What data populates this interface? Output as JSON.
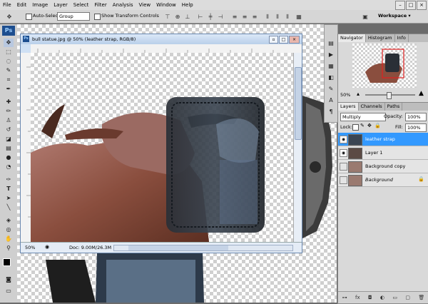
{
  "menu": {
    "logo": "Ps",
    "items": [
      "File",
      "Edit",
      "Image",
      "Layer",
      "Select",
      "Filter",
      "Analysis",
      "View",
      "Window",
      "Help"
    ],
    "window_controls": [
      "–",
      "□",
      "×"
    ]
  },
  "options": {
    "auto_select_label": "Auto-Select:",
    "auto_select_value": "Group",
    "show_transform_label": "Show Transform Controls",
    "workspace_label": "Workspace ▾"
  },
  "document": {
    "title": "bull statue.jpg @ 50% (leather strap, RGB/8)",
    "zoom": "50%",
    "doc_info": "Doc: 9.00M/26.3M",
    "title_buttons": [
      "▫",
      "□",
      "×"
    ]
  },
  "navigator": {
    "tabs": [
      "Navigator",
      "Histogram",
      "Info"
    ],
    "zoom": "50%"
  },
  "layers": {
    "tabs": [
      "Layers",
      "Channels",
      "Paths"
    ],
    "blend_mode": "Multiply",
    "opacity_label": "Opacity:",
    "opacity_value": "100%",
    "lock_label": "Lock:",
    "fill_label": "Fill:",
    "fill_value": "100%",
    "items": [
      {
        "name": "leather strap",
        "selected": true,
        "visible": true
      },
      {
        "name": "Layer 1",
        "selected": false,
        "visible": true
      },
      {
        "name": "Background copy",
        "selected": false,
        "visible": false
      },
      {
        "name": "Background",
        "selected": false,
        "visible": false,
        "locked": true
      }
    ],
    "footer_icons": [
      "link-icon",
      "fx-icon",
      "mask-icon",
      "adjustment-icon",
      "folder-icon",
      "new-layer-icon",
      "trash-icon"
    ],
    "footer_glyphs": [
      "⊶",
      "fx",
      "◘",
      "◐",
      "▭",
      "▢",
      "🗑"
    ]
  },
  "colors": {
    "accent": "#3399ff",
    "ps_logo_bg": "#1d4e8f"
  }
}
